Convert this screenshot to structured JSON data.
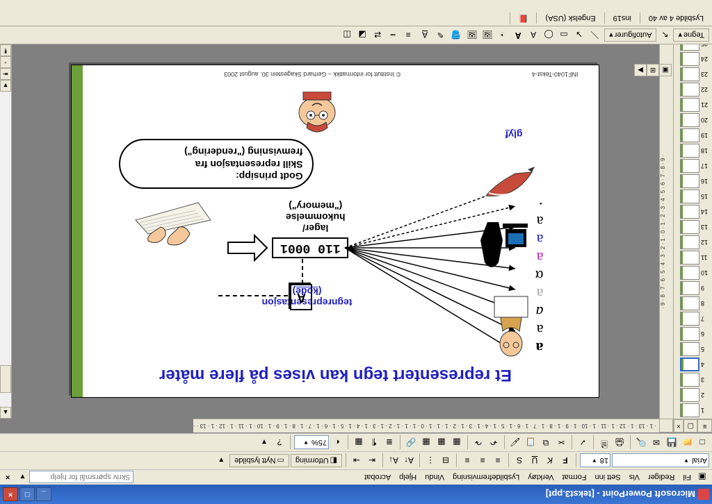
{
  "window": {
    "title": "Microsoft PowerPoint - [tekst3.ppt]"
  },
  "menu": {
    "items": [
      "Fil",
      "Rediger",
      "Vis",
      "Sett inn",
      "Format",
      "Verktøy",
      "Lysbildefremvisning",
      "Vindu",
      "Hjelp",
      "Acrobat"
    ],
    "help_placeholder": "Skriv spørsmål for hjelp",
    "close_x": "×"
  },
  "format_toolbar": {
    "font": "Arial",
    "size": "18",
    "bold": "F",
    "italic": "K",
    "underline": "U",
    "utforming": "Utforming",
    "nytt": "Nytt lysbilde"
  },
  "standard_toolbar": {
    "zoom": "75%"
  },
  "ruler": {
    "h": "· 1 · 13 · 1 · 12 · 1 · 11 · 1 · 10 · 1 · 9 · 1 · 8 · 1 · 7 · 1 · 6 · 1 · 5 · 1 · 4 · 1 · 3 · 1 · 2 · 1 · 1 · 1 · 0 · 1 · 1 · 1 · 2 · 1 · 3 · 1 · 4 · 1 · 5 · 1 · 6 · 1 · 7 · 1 · 8 · 1 · 9 · 1 · 10 · 1 · 11 · 1 · 12 · 1 · 13 · ·",
    "v": "· 9 · 8 · 7 · 6 · 5 · 4 · 3 · 2 · 1 · 0 · 1 · 2 · 3 · 4 · 5 · 6 · 7 · 8 · 9 ·"
  },
  "thumbnails": {
    "count": 25,
    "selected": 4
  },
  "slide": {
    "title": "Et representert tegn kan vises på flere måter",
    "glyphs": [
      "a",
      "a",
      "a",
      "a",
      "α",
      "a",
      "a",
      "a",
      "·"
    ],
    "glyph_colors": [
      "#000",
      "#000",
      "#000",
      "#aaa",
      "#000",
      "#c020c0",
      "#2020c0",
      "#000",
      "#000"
    ],
    "glyph_styles": [
      "bold serif",
      "serif",
      "italic",
      "serif",
      "serif",
      "serif",
      "serif",
      "script",
      "serif"
    ],
    "glyf_label": "glyf",
    "tegn_label_l1": "tegnrepresentasjon",
    "tegn_label_l2": "(kode)",
    "bits": "110 0001",
    "mem_l1": "lager/",
    "mem_l2": "hukommelse",
    "mem_l3": "(\"memory\")",
    "key_letter": "A",
    "callout_l1": "Godt prinsipp:",
    "callout_l2": "Skill representasjon fra",
    "callout_l3": "fremvisning (\"rendering\")",
    "footer_left": "INF1040-Tekst-4",
    "footer_mid": "© Institutt for informatikk – Gerhard Skagestein 30. august 2003"
  },
  "draw_toolbar": {
    "tegne": "Tegne",
    "autofig": "Autofigurer"
  },
  "status": {
    "slide": "Lysbilde 4 av 40",
    "design": "ins19",
    "lang": "Engelsk (USA)"
  }
}
